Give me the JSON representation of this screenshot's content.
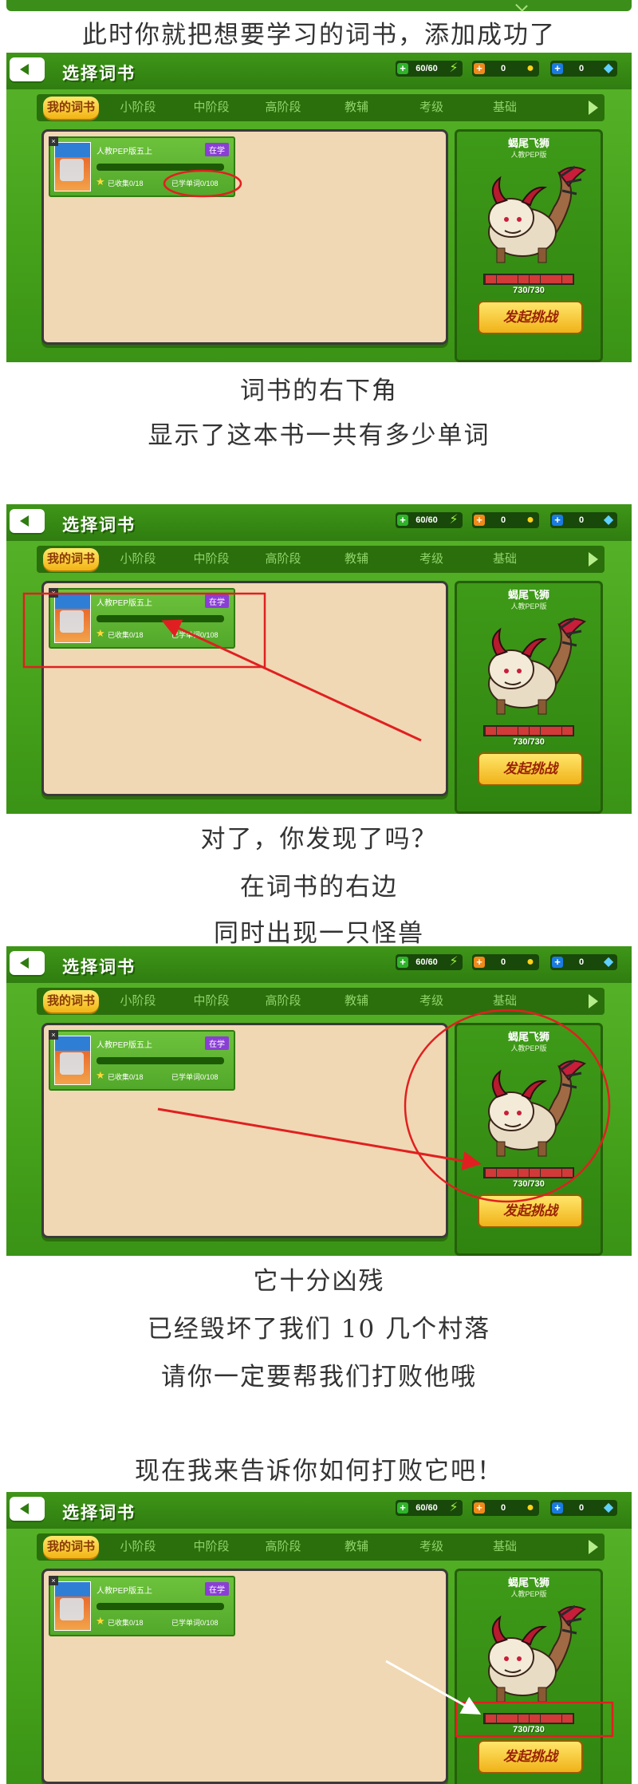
{
  "captions": {
    "c1": "此时你就把想要学习的词书，添加成功了",
    "c2": "词书的右下角",
    "c3": "显示了这本书一共有多少单词",
    "c4": "对了，你发现了吗？",
    "c5": "在词书的右边",
    "c6": "同时出现一只怪兽",
    "c7": "它十分凶残",
    "c8": "已经毁坏了我们 10 几个村落",
    "c9": "请你一定要帮我们打败他哦",
    "c10": "现在我来告诉你如何打败它吧！"
  },
  "screen": {
    "title": "选择词书",
    "resources": {
      "energy": "60/60",
      "orange": "0",
      "blue": "0"
    },
    "tabs": [
      "我的词书",
      "小阶段",
      "中阶段",
      "高阶段",
      "教辅",
      "考级",
      "基础"
    ],
    "book": {
      "name": "人教PEP版五上",
      "status": "在学",
      "collected": "已收集0/18",
      "learned": "已学单词0/108",
      "cover_badge": "×"
    },
    "monster": {
      "name": "蝎尾飞狮",
      "edition": "人教PEP版",
      "hp": "730/730",
      "hp_fraction": 1.0
    },
    "challenge_label": "发起挑战"
  },
  "colors": {
    "game_green": "#4aa81f",
    "highlight_red": "#e02020",
    "tab_gold": "#f2b414",
    "status_purple": "#8a3ed6"
  }
}
